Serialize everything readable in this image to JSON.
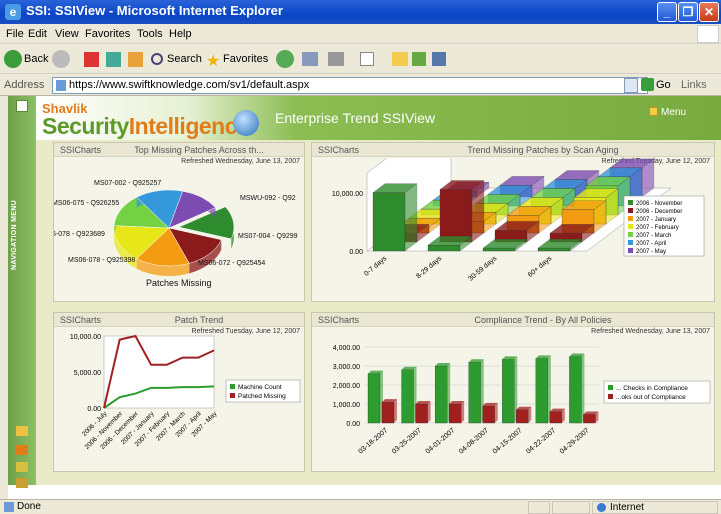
{
  "window": {
    "title": "SSI: SSIView - Microsoft Internet Explorer"
  },
  "menu": [
    "File",
    "Edit",
    "View",
    "Favorites",
    "Tools",
    "Help"
  ],
  "toolbar": {
    "back": "Back",
    "search": "Search",
    "favorites": "Favorites"
  },
  "address": {
    "label": "Address",
    "url": "https://www.swiftknowledge.com/sv1/default.aspx",
    "go": "Go",
    "links": "Links"
  },
  "banner": {
    "brand_top": "Shavlik",
    "brand_security": "Security",
    "brand_intelligence": "Intelligence",
    "title": "Enterprise Trend SSIView",
    "menu": "Menu"
  },
  "nav": {
    "label": "NAVIGATION MENU"
  },
  "panels": [
    {
      "source": "SSICharts",
      "title": "Top Missing Patches Across th...",
      "refreshed": "Refreshed Wednesday, June 13, 2007"
    },
    {
      "source": "SSICharts",
      "title": "Trend Missing Patches by Scan Aging",
      "refreshed": "Refreshed Tuesday, June 12, 2007"
    },
    {
      "source": "SSICharts",
      "title": "Patch Trend",
      "refreshed": "Refreshed Tuesday, June 12, 2007"
    },
    {
      "source": "SSICharts",
      "title": "Compliance Trend - By All Policies",
      "refreshed": "Refreshed Wednesday, June 13, 2007"
    }
  ],
  "chart_data": [
    {
      "type": "pie",
      "title": "Top Missing Patches Across th...",
      "xlabel": "Patches Missing",
      "labels": [
        "MSWU-092 - Q92",
        "MS07-004 - Q9299",
        "MS06-072 - Q925454",
        "MS06-078 - Q925398",
        "6-078 - Q923689",
        "MS06-075 - Q926255",
        "MS07-002 - Q925257"
      ],
      "values": [
        14,
        14,
        16,
        16,
        14,
        14,
        12
      ],
      "colors": [
        "#2e8b2e",
        "#8b1a1a",
        "#f39c12",
        "#e6e619",
        "#74d144",
        "#3498db",
        "#7d4cb3"
      ]
    },
    {
      "type": "bar",
      "title": "Trend Missing Patches by Scan Aging",
      "categories": [
        "0-7 days",
        "8-29 days",
        "30-59 days",
        "60+ days"
      ],
      "yticks": [
        "0.00",
        "10,000.00"
      ],
      "series": [
        {
          "name": "2006 - November",
          "color": "#2e8b2e",
          "values": [
            10000,
            1000,
            500,
            500
          ]
        },
        {
          "name": "2006 - December",
          "color": "#8b1a1a",
          "values": [
            1500,
            9000,
            2000,
            1500
          ]
        },
        {
          "name": "2007 - January",
          "color": "#f39c12",
          "values": [
            1000,
            2000,
            3000,
            4000
          ]
        },
        {
          "name": "2007 - February",
          "color": "#e6e619",
          "values": [
            1000,
            2000,
            3000,
            4500
          ]
        },
        {
          "name": "2007 - March",
          "color": "#74d144",
          "values": [
            1000,
            2000,
            3000,
            5000
          ]
        },
        {
          "name": "2007 - April",
          "color": "#3498db",
          "values": [
            1000,
            2000,
            3000,
            5000
          ]
        },
        {
          "name": "2007 - May",
          "color": "#7d4cb3",
          "values": [
            1000,
            2000,
            3000,
            5000
          ]
        }
      ]
    },
    {
      "type": "line",
      "title": "Patch Trend",
      "categories": [
        "2006 - July",
        "2006 - November",
        "2006 - December",
        "2007 - January",
        "2007 - February",
        "2007 - March",
        "2007 - April",
        "2007 - May"
      ],
      "yticks": [
        "0.00",
        "5,000.00",
        "10,000.00"
      ],
      "ylim": [
        0,
        10000
      ],
      "series": [
        {
          "name": "Machine Count",
          "color": "#2e9b2e",
          "values": [
            0,
            1500,
            2000,
            2800,
            2800,
            2900,
            2900,
            3000
          ]
        },
        {
          "name": "Patched Missing",
          "color": "#a02020",
          "values": [
            0,
            9500,
            10000,
            6000,
            6000,
            7000,
            7000,
            8000
          ]
        }
      ]
    },
    {
      "type": "bar",
      "title": "Compliance Trend - By All Policies",
      "categories": [
        "03-18-2007",
        "03-25-2007",
        "04-01-2007",
        "04-08-2007",
        "04-15-2007",
        "04-22-2007",
        "04-29-2007"
      ],
      "yticks": [
        "0.00",
        "1,000.00",
        "2,000.00",
        "3,000.00",
        "4,000.00"
      ],
      "ylim": [
        0,
        4000
      ],
      "series": [
        {
          "name": "... Checks in Compliance",
          "color": "#2e9b2e",
          "values": [
            2600,
            2800,
            3000,
            3200,
            3350,
            3400,
            3500
          ]
        },
        {
          "name": "...oks out of Compliance",
          "color": "#a02020",
          "values": [
            1100,
            1000,
            1000,
            900,
            700,
            600,
            450
          ]
        }
      ]
    }
  ],
  "status": {
    "left": "Done",
    "zone": "Internet"
  }
}
